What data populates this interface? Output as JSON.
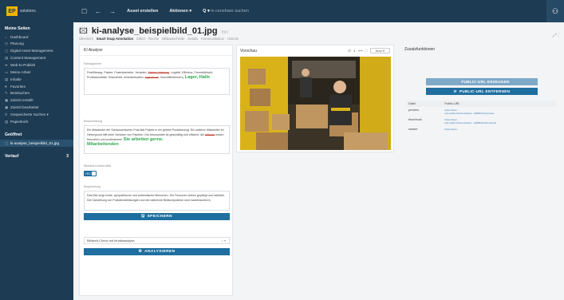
{
  "topbar": {
    "logo_mark": "EP",
    "logo_text": "solutions",
    "create_asset": "Asset erstellen",
    "actions": "Aktionen ▾",
    "search_placeholder": "in censhare suchen"
  },
  "sidebar": {
    "my_pages_heading": "Meine Seiten",
    "items": [
      {
        "icon": "⌂",
        "label": "Dashboard"
      },
      {
        "icon": "◷",
        "label": "Planung"
      },
      {
        "icon": "▢",
        "label": "Digital Asset Management"
      },
      {
        "icon": "▤",
        "label": "Content Management"
      },
      {
        "icon": "➦",
        "label": "Web-to-Publish"
      },
      {
        "icon": "▭",
        "label": "Meine Arbeit"
      },
      {
        "icon": "▤",
        "label": "Inhalte"
      },
      {
        "icon": "♥",
        "label": "Favoriten"
      },
      {
        "icon": "✎",
        "label": "Bestsuchen"
      },
      {
        "icon": "▣",
        "label": "Zuletzt erstellt"
      },
      {
        "icon": "▣",
        "label": "Zuletzt bearbeitet"
      },
      {
        "icon": "⚲",
        "label": "Gespeicherte Suchen ▾"
      },
      {
        "icon": "▥",
        "label": "Papierkorb"
      }
    ],
    "opened_heading": "Geöffnet",
    "opened_item": "ki-analyse_beispielbild_01.jpg",
    "history_heading": "Verlauf",
    "history_count": "3"
  },
  "asset": {
    "title": "ki-analyse_beispielbild_01.jpg",
    "badge": "Bild",
    "tabs": [
      "Übersicht",
      "Smart Snap Annotation",
      "Editor",
      "Rechte",
      "Bildausschnitte",
      "Details",
      "Kommunikation",
      "Historie"
    ],
    "active_tab": 1
  },
  "ki_panel": {
    "title": "KI Analyse",
    "keywords_label": "Schlagwörter",
    "keywords_text": "Postfiliewag, Pakete, Postmitarbeiter, Verladen,",
    "keywords_strike1": "Stefan Lieferung",
    "keywords_mid": ", Logistik, Effizienz, Freundlichkeit, Professionalität, Teamarbeit, Arbeitssituation,",
    "keywords_strike2": "Ingenieure",
    "keywords_end": ", Geschäftsbereich",
    "keywords_added": ", Lager, Halle",
    "desc_label": "Beschreibung",
    "desc_text": "Ein Mitarbeiter der Schweizerischen Post lädt Pakete in ein gelbes Postfahrzeug. Ein weiterer Mitarbeiter im Hintergrund hilft beim Verladen von Paketen. Die Atmosphäre ist geschäftig und effizient, die",
    "desc_strike": "Männer",
    "desc_mid": "wirken freundlich und professionell.",
    "desc_added1": "Sie arbeiten gerne.",
    "desc_added2": "Mitarbeitenden",
    "personal_label": "Bildwelt-Konformität",
    "toggle_value": "YES",
    "reason_label": "Begründung",
    "reason_text": "Das Bild zeigt echte, sympathische und authentische Menschen. Die Personen wirken gepflegt und natürlich. Die Darstellung von Postdienstleistungen und die natürliche Bildkomposition sind markenkonform.",
    "save_button": "SPEICHERN",
    "check_select": "Bildwelt-Check mit Inhaltsanalyse",
    "analyze_button": "ANALYSIEREN"
  },
  "preview": {
    "title": "Vorschau",
    "zoom": "Auto"
  },
  "zusatz": {
    "title": "Zusatzfunktionen",
    "create_button": "PUBLIC-URL ERZEUGEN",
    "remove_button": "PUBLIC-URL ENTFERNEN",
    "table_headers": [
      "Datei",
      "Public-URL"
    ],
    "rows": [
      {
        "file": "preview",
        "short": "https://stan-",
        "long": "test.public.link/censhare/.../a9f8b32d-preview"
      },
      {
        "file": "thumbnail",
        "short": "https://stan-",
        "long": "test.public.link/censhare/.../a9f8b32d-thumbnail"
      },
      {
        "file": "master",
        "short": "https://stan-",
        "long": ""
      }
    ]
  },
  "colors": {
    "nav": "#1d3b52",
    "accent": "#1e6fa0",
    "added_text": "#2fa84f",
    "removed_text": "#c0392b"
  }
}
